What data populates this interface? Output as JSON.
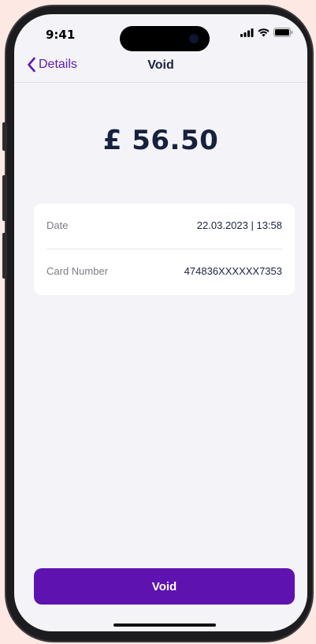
{
  "status_bar": {
    "time": "9:41",
    "icons": [
      "signal-icon",
      "wifi-icon",
      "battery-icon"
    ]
  },
  "nav": {
    "back_label": "Details",
    "title": "Void"
  },
  "transaction": {
    "amount": "£ 56.50",
    "rows": [
      {
        "label": "Date",
        "value": "22.03.2023 | 13:58"
      },
      {
        "label": "Card Number",
        "value": "474836XXXXXX7353"
      }
    ]
  },
  "actions": {
    "void_label": "Void"
  },
  "colors": {
    "accent": "#5e13b0",
    "background": "#f4f3f8",
    "text_dark": "#1b2340",
    "text_muted": "#7d7d86"
  }
}
